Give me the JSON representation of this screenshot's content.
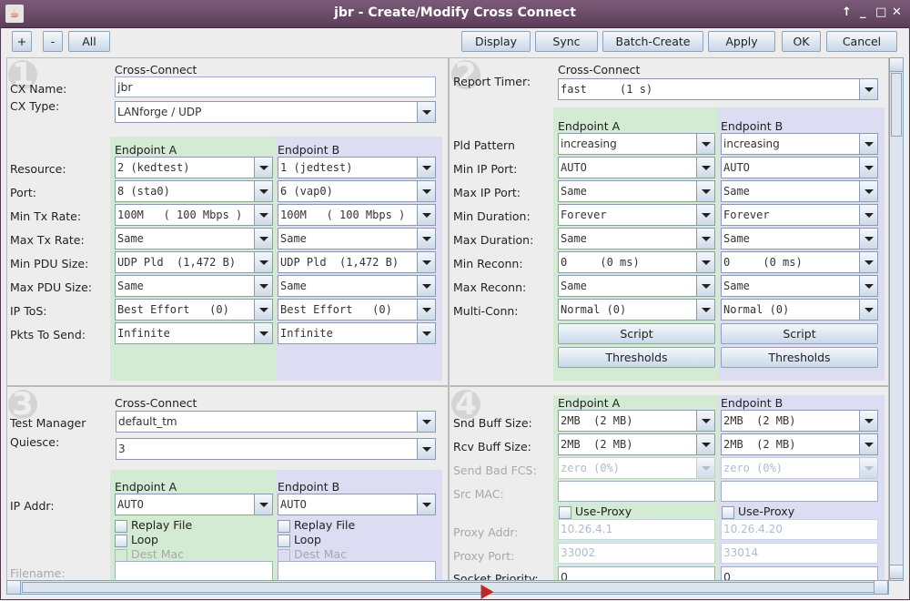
{
  "window": {
    "title": "jbr - Create/Modify Cross Connect",
    "controls": [
      "↑",
      "_",
      "□",
      "✕"
    ]
  },
  "toolbar": {
    "left": [
      "+",
      "-",
      "All"
    ],
    "right": [
      "Display",
      "Sync",
      "Batch-Create",
      "Apply",
      "OK",
      "Cancel"
    ]
  },
  "panel1": {
    "number": "1",
    "section": "Cross-Connect",
    "cx_name_label": "CX Name:",
    "cx_name": "jbr",
    "cx_type_label": "CX Type:",
    "cx_type": "LANforge / UDP",
    "endpoint_a": "Endpoint A",
    "endpoint_b": "Endpoint B",
    "rows": [
      {
        "label": "Resource:",
        "a": "2 (kedtest)",
        "b": "1 (jedtest)"
      },
      {
        "label": "Port:",
        "a": "8 (sta0)",
        "b": "6 (vap0)"
      },
      {
        "label": "Min Tx Rate:",
        "a": "100M   ( 100 Mbps )",
        "b": "100M   ( 100 Mbps )"
      },
      {
        "label": "Max Tx Rate:",
        "a": "Same",
        "b": "Same"
      },
      {
        "label": "Min PDU Size:",
        "a": "UDP Pld  (1,472 B)",
        "b": "UDP Pld  (1,472 B)"
      },
      {
        "label": "Max PDU Size:",
        "a": "Same",
        "b": "Same"
      },
      {
        "label": "IP ToS:",
        "a": "Best Effort   (0)",
        "b": "Best Effort   (0)"
      },
      {
        "label": "Pkts To Send:",
        "a": "Infinite",
        "b": "Infinite"
      }
    ]
  },
  "panel2": {
    "number": "2",
    "section": "Cross-Connect",
    "report_timer_label": "Report Timer:",
    "report_timer": "fast     (1 s)",
    "endpoint_a": "Endpoint A",
    "endpoint_b": "Endpoint B",
    "rows": [
      {
        "label": "Pld Pattern",
        "a": "increasing",
        "b": "increasing"
      },
      {
        "label": "Min IP Port:",
        "a": "AUTO",
        "b": "AUTO"
      },
      {
        "label": "Max IP Port:",
        "a": "Same",
        "b": "Same"
      },
      {
        "label": "Min Duration:",
        "a": "Forever",
        "b": "Forever"
      },
      {
        "label": "Max Duration:",
        "a": "Same",
        "b": "Same"
      },
      {
        "label": "Min Reconn:",
        "a": "0     (0 ms)",
        "b": "0     (0 ms)"
      },
      {
        "label": "Max Reconn:",
        "a": "Same",
        "b": "Same"
      },
      {
        "label": "Multi-Conn:",
        "a": "Normal (0)",
        "b": "Normal (0)"
      }
    ],
    "script_label": "Script",
    "thresholds_label": "Thresholds"
  },
  "panel3": {
    "number": "3",
    "section": "Cross-Connect",
    "test_manager_label": "Test Manager",
    "test_manager": "default_tm",
    "quiesce_label": "Quiesce:",
    "quiesce": "3",
    "endpoint_a": "Endpoint A",
    "endpoint_b": "Endpoint B",
    "ip_addr_label": "IP Addr:",
    "ip_a": "AUTO",
    "ip_b": "AUTO",
    "replay_file": "Replay File",
    "loop": "Loop",
    "dest_mac": "Dest Mac",
    "filename_label": "Filename:"
  },
  "panel4": {
    "number": "4",
    "endpoint_a": "Endpoint A",
    "endpoint_b": "Endpoint B",
    "rows": [
      {
        "label": "Snd Buff Size:",
        "a": "2MB  (2 MB)",
        "b": "2MB  (2 MB)"
      },
      {
        "label": "Rcv Buff Size:",
        "a": "2MB  (2 MB)",
        "b": "2MB  (2 MB)"
      },
      {
        "label": "Send Bad FCS:",
        "a": "zero (0%)",
        "b": "zero (0%)"
      }
    ],
    "src_mac_label": "Src MAC:",
    "use_proxy": "Use-Proxy",
    "proxy_addr_label": "Proxy Addr:",
    "proxy_addr_a": "10.26.4.1",
    "proxy_addr_b": "10.26.4.20",
    "proxy_port_label": "Proxy Port:",
    "proxy_port_a": "33002",
    "proxy_port_b": "33014",
    "socket_priority_label": "Socket Priority:",
    "socket_priority_a": "0",
    "socket_priority_b": "0"
  },
  "colors": {
    "endpoint_a_bg": "#d3ead3",
    "endpoint_b_bg": "#dcdcf2",
    "titlebar": "#6a4a68"
  }
}
